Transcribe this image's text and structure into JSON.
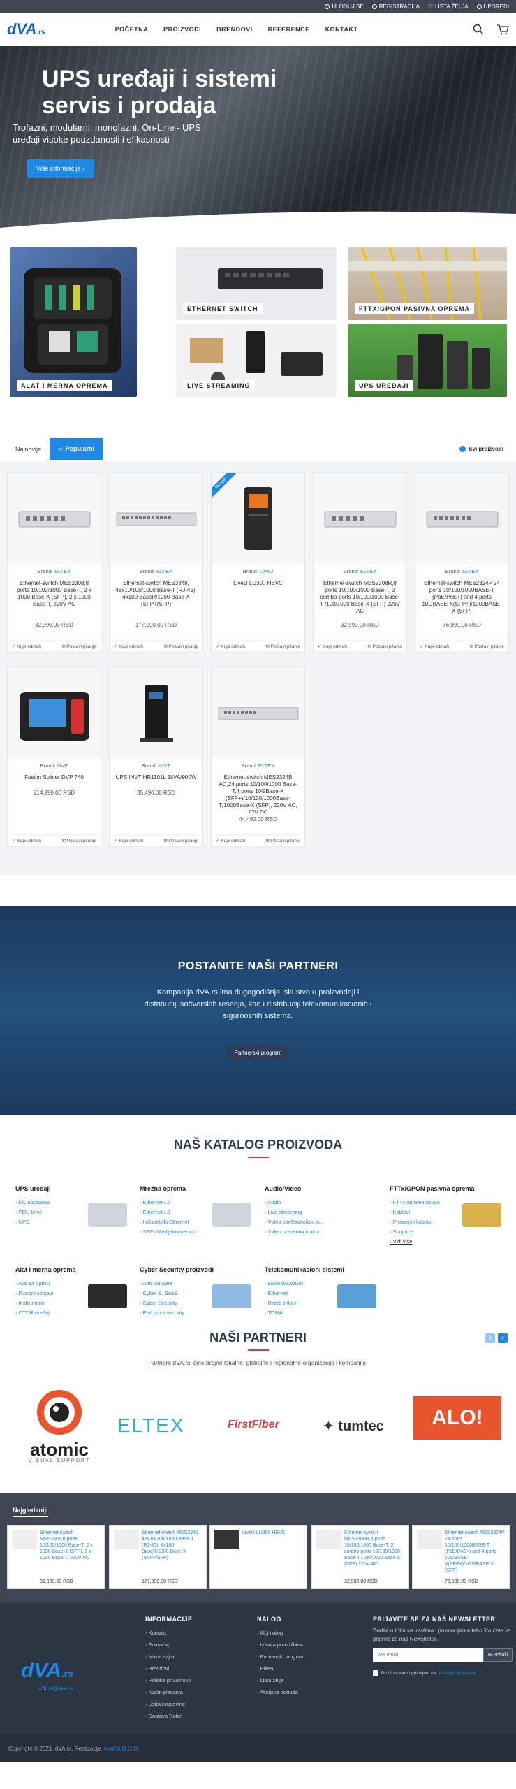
{
  "topbar": {
    "login": "ULOGUJ SE",
    "register": "REGISTRACIJA",
    "wishlist": "LISTA ŽELJA",
    "compare": "UPOREDI"
  },
  "header": {
    "logo_main": "dVA",
    "logo_suffix": ".rs",
    "nav": [
      "POČETNA",
      "PROIZVODI",
      "BRENDOVI",
      "REFERENCE",
      "KONTAKT"
    ]
  },
  "hero": {
    "title": "UPS uređaji i sistemi servis i prodaja",
    "subtitle": "Trofazni, modularni, monofazni, On-Line - UPS uređaji visoke pouzdanosti i efikasnosti",
    "button": "Više informacija"
  },
  "categories": [
    {
      "label": "ALAT I MERNA OPREMA"
    },
    {
      "label": "ETHERNET SWITCH"
    },
    {
      "label": "FTTX/GPON PASIVNA OPREMA"
    },
    {
      "label": "LIVE STREAMING"
    },
    {
      "label": "UPS UREĐAJI"
    }
  ],
  "product_tabs": {
    "newest": "Najnovije",
    "popular": "Popularni",
    "all": "Svi proizvodi"
  },
  "products": [
    {
      "brand": "ELTEX",
      "title": "Ethernet-switch MES2308,8 ports 10/100/1000 Base-T, 2 x 1000 Base-X (SFP), 2 x 1000 Base-T, 220V AC",
      "price": "32,990.00 RSD"
    },
    {
      "brand": "ELTEX",
      "title": "Ethernet-switch MES3348, 48x10/100/1000 Base-T (RJ-45), 4x100 BaseR/1000 Base-X (SFP+/SFP)",
      "price": "177,990.00 RSD"
    },
    {
      "brand": "LiveU",
      "title": "LiveU LU300 HEVC",
      "price": "",
      "badge": "Na upit"
    },
    {
      "brand": "ELTEX",
      "title": "Ethernet-switch MES2308R,8 ports 10/100/1000 Base-T, 2 combo-ports 10/100/1000 Base-T /100/1000 Base-X (SFP) 220V AC",
      "price": "32,990.00 RSD"
    },
    {
      "brand": "ELTEX",
      "title": "Ethernet-switch MES2324P 24 ports 10/100/1000BASE-T (PoE/PoE+) and 4 ports 10GBASE-X(SFP+)/1000BASE-X (SFP)",
      "price": "76,990.00 RSD"
    },
    {
      "brand": "DVP",
      "title": "Fusion Splicer DVP 740",
      "price": "214,990.00 RSD"
    },
    {
      "brand": "INVT",
      "title": "UPS INVT HR1101L 1kVA/900W",
      "price": "35,490.00 RSD"
    },
    {
      "brand": "ELTEX",
      "title": "Ethernet-switch MES2324B AC,24 ports 10/100/1000 Base-T,4 ports 10GBase-X (SFP+)/10/100/1000Base-T/1000Base-X (SFP), 220V AC, 12V DC",
      "price": "44,490.00 RSD"
    }
  ],
  "product_labels": {
    "brand_prefix": "Brand:",
    "buy": "Kupi odmah",
    "ask": "Postavi pitanje"
  },
  "partners_band": {
    "title": "POSTANITE NAŠI PARTNERI",
    "text": "Kompanija dVA.rs ima dugogodišnje iskustvo u proizvodnji i distribuciji softverskih rešenja, kao i distribuciji telekomunikacionih i sigurnosnih sistema.",
    "button": "Partnerski program"
  },
  "catalog": {
    "title": "NAŠ KATALOG PROIZVODA",
    "columns": [
      {
        "title": "UPS uređaji",
        "items": [
          "DC napajanja",
          "PDU letve",
          "UPS"
        ]
      },
      {
        "title": "Mrežna oprema",
        "items": [
          "Ethernet L2",
          "Ethernet L3",
          "Industrijski Ethernet",
          "SFP i Medijakonvertori"
        ]
      },
      {
        "title": "Audio/Video",
        "items": [
          "Audio",
          "Live streaming",
          "Video konferencijski si...",
          "Video prezentacioni si..."
        ]
      },
      {
        "title": "FTTx/GPON pasivna oprema",
        "items": [
          "FTTx oprema ostalo",
          "Kablovi",
          "Prespojni kablovi",
          "Spojnice"
        ],
        "more": "Vidi više"
      },
      {
        "title": "Alat i merna oprema",
        "items": [
          "Alat za optiku",
          "Fusioni spojevi",
          "Instrumenti",
          "OTDR uređaji"
        ]
      },
      {
        "title": "Cyber Security proizvodi",
        "items": [
          "Anti Malware",
          "Cyber S. SaaS",
          "Cyber Security",
          "End point security"
        ]
      },
      {
        "title": "Telekomunikacioni sistemi",
        "items": [
          "DWDM/CWDM",
          "Ethernet",
          "Radio linkovi",
          "TDMA"
        ]
      }
    ]
  },
  "our_partners": {
    "title": "NAŠI PARTNERI",
    "text": "Partnere dVA.rs, čine brojne lokalne, globalne i regionalne organizacije i kompanije.",
    "logos": {
      "atomic": "atomic",
      "atomic_sub": "VISUAL SUPPORT",
      "eltex": "ELTEX",
      "firstfiber": "FirstFiber",
      "tumtec": "tumtec",
      "alo": "ALO!"
    }
  },
  "recent": {
    "title": "Najgledaniji",
    "items": [
      {
        "title": "Ethernet-switch MES2308,8 ports 10/100/1000 Base-T, 2 x 1000 Base-X (SFP), 2 x 1000 Base-T, 220V AC",
        "price": "32,990.00 RSD"
      },
      {
        "title": "Ethernet-switch MES3348, 48x10/100/1000 Base-T (RJ-45), 4x100 BaseR/1000 Base-X (SFP+/SFP)",
        "price": "177,990.00 RSD"
      },
      {
        "title": "LiveU LU300 HEVC",
        "price": ""
      },
      {
        "title": "Ethernet-switch MES2308R,8 ports 10/100/1000 Base-T, 2 combo-ports 10/100/1000 Base-T /100/1000 Base-X (SFP) 220V AC",
        "price": "32,990.00 RSD"
      },
      {
        "title": "Ethernet-switch MES2324P 24 ports 10/100/1000BASE-T (PoE/PoE+) and 4 ports 10GBASE-X(SFP+)/1000BASE-X (SFP)",
        "price": "76,990.00 RSD"
      }
    ]
  },
  "footer": {
    "email": "office@dva.rs",
    "info": {
      "title": "INFORMACIJE",
      "items": [
        "Kontakt",
        "Povraćaj",
        "Mapa sajta",
        "Brendovi",
        "Politika privatnosti",
        "Način plaćanja",
        "Uslovi kupovine",
        "Dostava Robe"
      ]
    },
    "account": {
      "title": "NALOG",
      "items": [
        "Moj nalog",
        "Istorija porudžbina",
        "Partnerski program",
        "Bilten",
        "Lista želja",
        "Akcijska ponuda"
      ]
    },
    "newsletter": {
      "title": "PRIJAVITE SE ZA NAŠ NEWSLETTER",
      "text": "Budite u toku sa vestima i promocijama tako što ćete se prijaviti za naš Newsletter.",
      "placeholder": "Vaš email",
      "button": "Pošalji",
      "consent": "Pročitao sam i pristajem na",
      "consent_link": "Politiku Privatnosti"
    }
  },
  "copyright": {
    "text": "Copyright © 2021. dVA.rs, Realizacija",
    "link": "Avalon D.O.O."
  }
}
